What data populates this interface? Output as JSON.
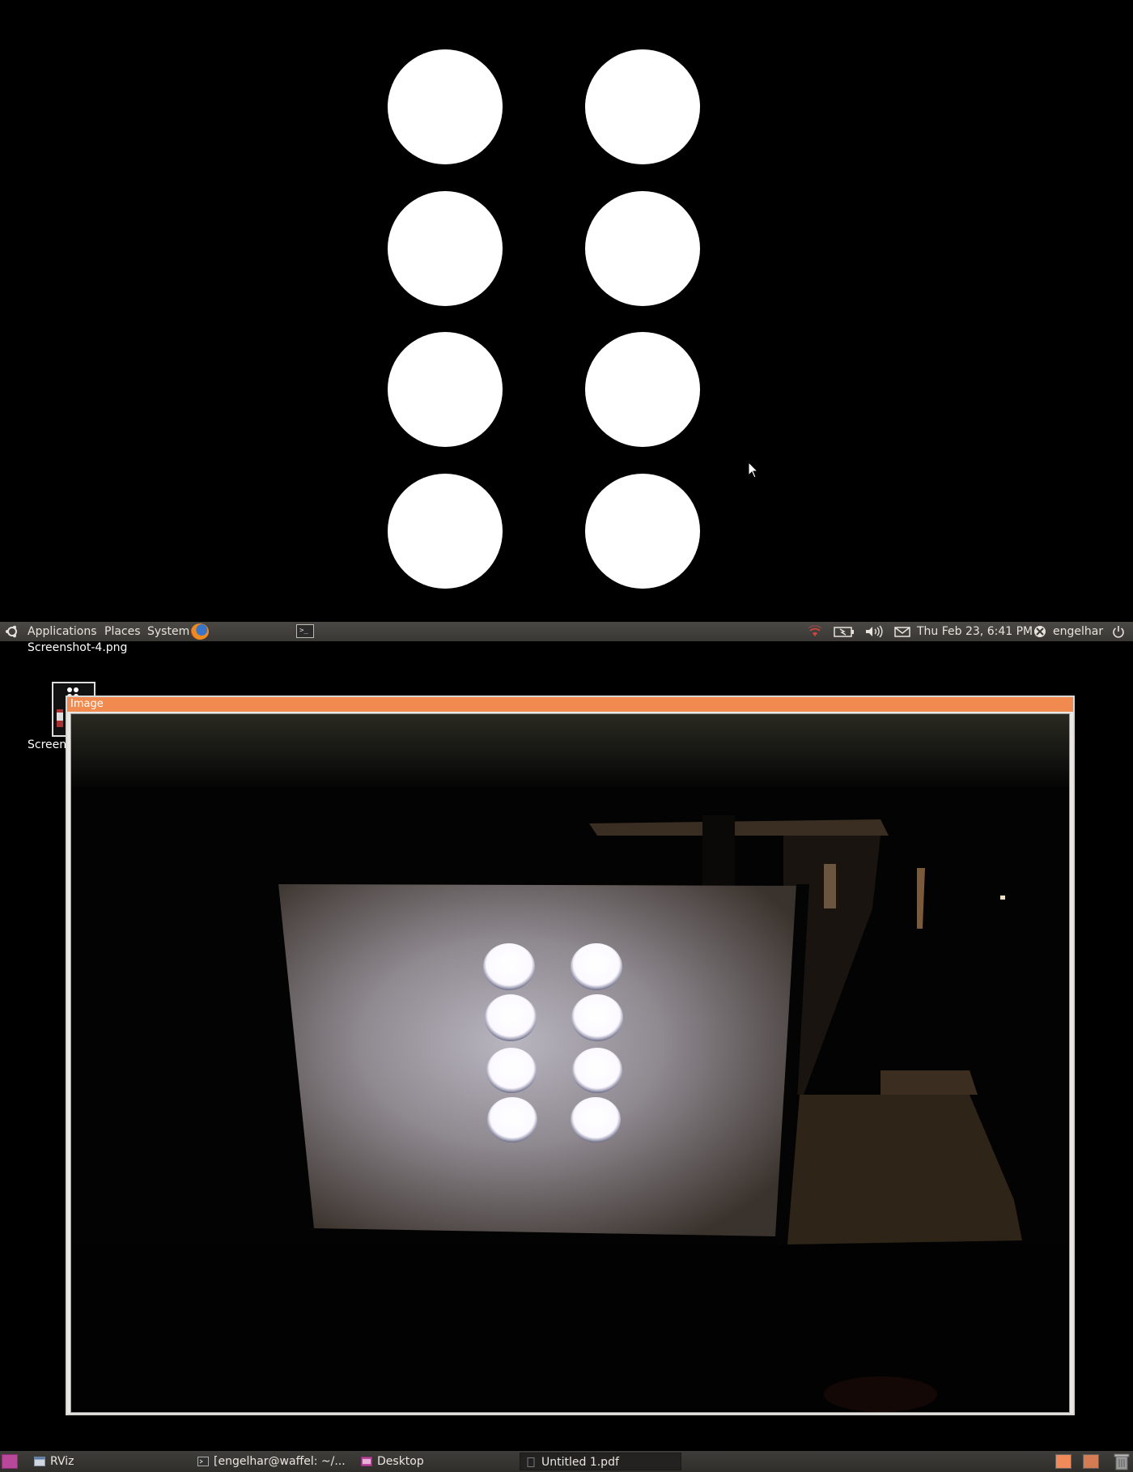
{
  "top_panel": {
    "menus": [
      "Applications",
      "Places",
      "System"
    ],
    "datetime": "Thu Feb 23,  6:41 PM",
    "user": "engelhar"
  },
  "desktop": {
    "icon_label_1": "Screenshot-4.png",
    "icon_label_2": "Screens"
  },
  "image_window": {
    "title": "Image"
  },
  "bottom_panel": {
    "tasks": [
      "RViz",
      "[engelhar@waffel: ~/...",
      "Desktop",
      "Untitled 1.pdf"
    ]
  },
  "colors": {
    "window_accent": "#f18a4f",
    "panel_bg": "#3c3b37"
  }
}
